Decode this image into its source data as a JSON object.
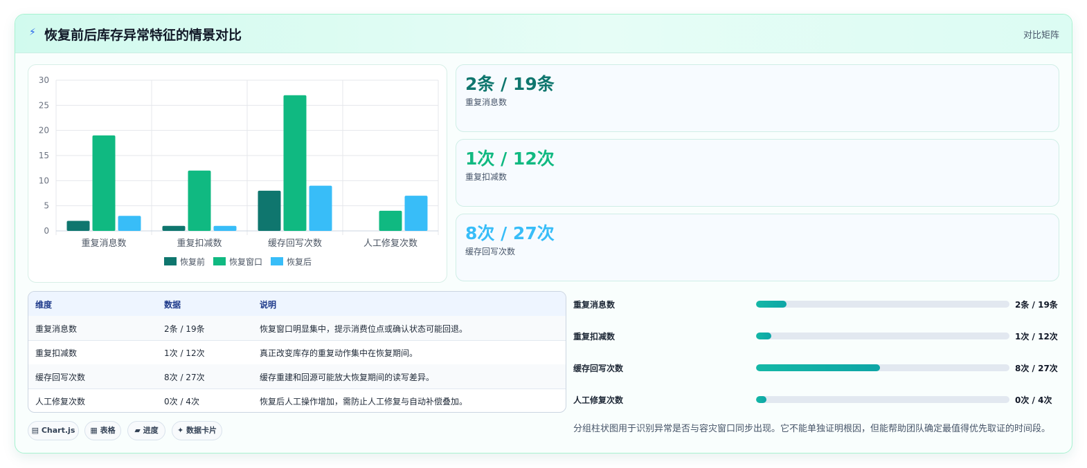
{
  "header": {
    "icon": "bolt-icon",
    "title": "恢复前后库存异常特征的情景对比",
    "tag": "对比矩阵"
  },
  "colors": {
    "before": "#0f766e",
    "window": "#10b981",
    "after": "#38bdf8"
  },
  "chart_data": {
    "type": "bar",
    "title": "",
    "xlabel": "",
    "ylabel": "",
    "categories": [
      "重复消息数",
      "重复扣减数",
      "缓存回写次数",
      "人工修复次数"
    ],
    "series": [
      {
        "name": "恢复前",
        "values": [
          2,
          1,
          8,
          0
        ]
      },
      {
        "name": "恢复窗口",
        "values": [
          19,
          12,
          27,
          4
        ]
      },
      {
        "name": "恢复后",
        "values": [
          3,
          1,
          9,
          7
        ]
      }
    ],
    "ylim": [
      0,
      30
    ],
    "yticks": [
      0,
      5,
      10,
      15,
      20,
      25,
      30
    ],
    "grid": true,
    "legend": "bottom"
  },
  "kpis": [
    {
      "value": "2条 / 19条",
      "label": "重复消息数",
      "color": "#0f766e"
    },
    {
      "value": "1次 / 12次",
      "label": "重复扣减数",
      "color": "#10b981"
    },
    {
      "value": "8次 / 27次",
      "label": "缓存回写次数",
      "color": "#38bdf8"
    }
  ],
  "table": {
    "headers": [
      "维度",
      "数据",
      "说明"
    ],
    "rows": [
      [
        "重复消息数",
        "2条 / 19条",
        "恢复窗口明显集中，提示消费位点或确认状态可能回退。"
      ],
      [
        "重复扣减数",
        "1次 / 12次",
        "真正改变库存的重复动作集中在恢复期间。"
      ],
      [
        "缓存回写次数",
        "8次 / 27次",
        "缓存重建和回源可能放大恢复期间的读写差异。"
      ],
      [
        "人工修复次数",
        "0次 / 4次",
        "恢复后人工操作增加，需防止人工修复与自动补偿叠加。"
      ]
    ]
  },
  "progress": [
    {
      "label": "重复消息数",
      "value": "2条 / 19条",
      "fraction": 0.12
    },
    {
      "label": "重复扣减数",
      "value": "1次 / 12次",
      "fraction": 0.06
    },
    {
      "label": "缓存回写次数",
      "value": "8次 / 27次",
      "fraction": 0.49
    },
    {
      "label": "人工修复次数",
      "value": "0次 / 4次",
      "fraction": 0.04
    }
  ],
  "chips": [
    {
      "icon": "chart-icon",
      "glyph": "▤",
      "label": "Chart.js"
    },
    {
      "icon": "table-icon",
      "glyph": "▦",
      "label": "表格"
    },
    {
      "icon": "progress-icon",
      "glyph": "▰",
      "label": "进度"
    },
    {
      "icon": "sparkle-icon",
      "glyph": "✦",
      "label": "数据卡片"
    }
  ],
  "note": "分组柱状图用于识别异常是否与容灾窗口同步出现。它不能单独证明根因，但能帮助团队确定最值得优先取证的时间段。"
}
